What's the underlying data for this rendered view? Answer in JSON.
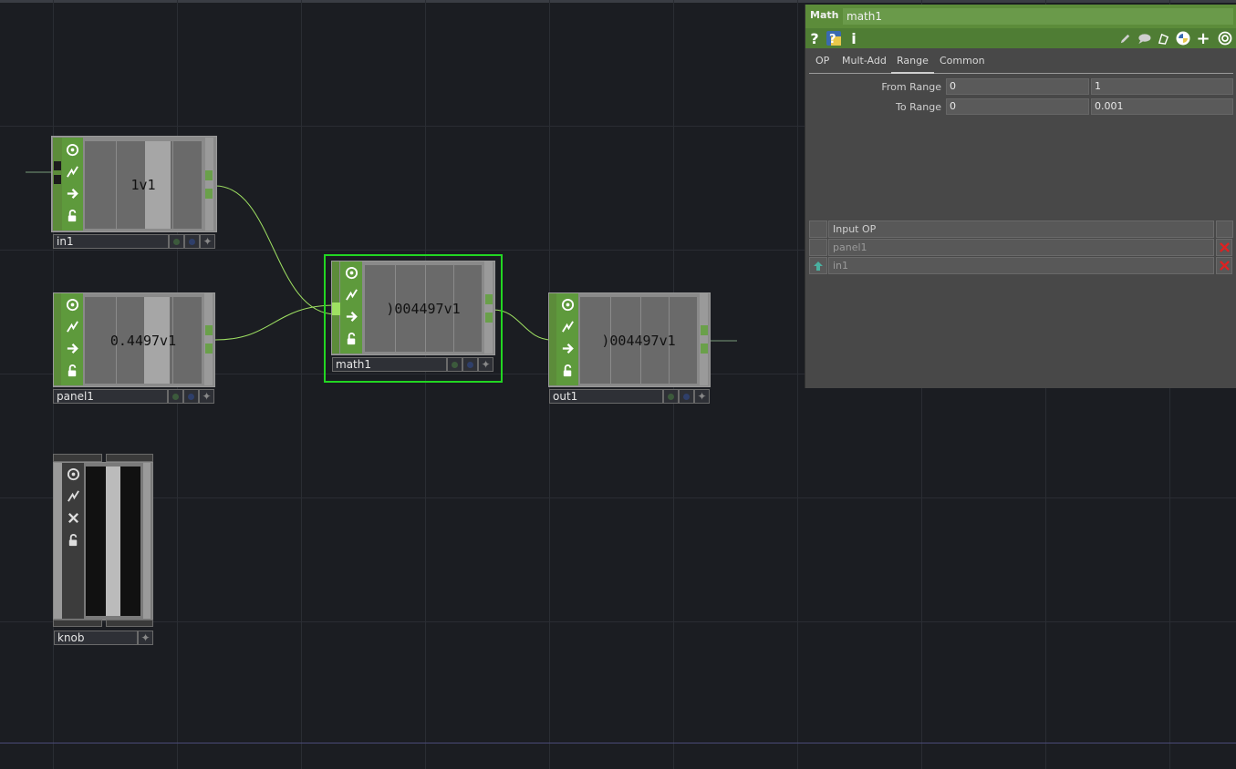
{
  "nodes": {
    "in1": {
      "name": "in1",
      "value": "1v1"
    },
    "panel1": {
      "name": "panel1",
      "value": "0.4497v1"
    },
    "math1": {
      "name": "math1",
      "value": ")004497v1"
    },
    "out1": {
      "name": "out1",
      "value": ")004497v1"
    },
    "knob": {
      "name": "knob"
    }
  },
  "params": {
    "op_type": "Math",
    "op_name": "math1",
    "toolbar": {
      "help": "?",
      "info": "i"
    },
    "tabs": [
      "OP",
      "Mult-Add",
      "Range",
      "Common"
    ],
    "active_tab": "Range",
    "from_range": {
      "label": "From Range",
      "v1": "0",
      "v2": "1"
    },
    "to_range": {
      "label": "To Range",
      "v1": "0",
      "v2": "0.001"
    },
    "input_table": {
      "header": "Input OP",
      "rows": [
        "panel1",
        "in1"
      ]
    }
  },
  "colors": {
    "operator_green": "#5c8c3a",
    "selection": "#22d622",
    "wire": "#9ee062",
    "remove": "#e02020"
  }
}
